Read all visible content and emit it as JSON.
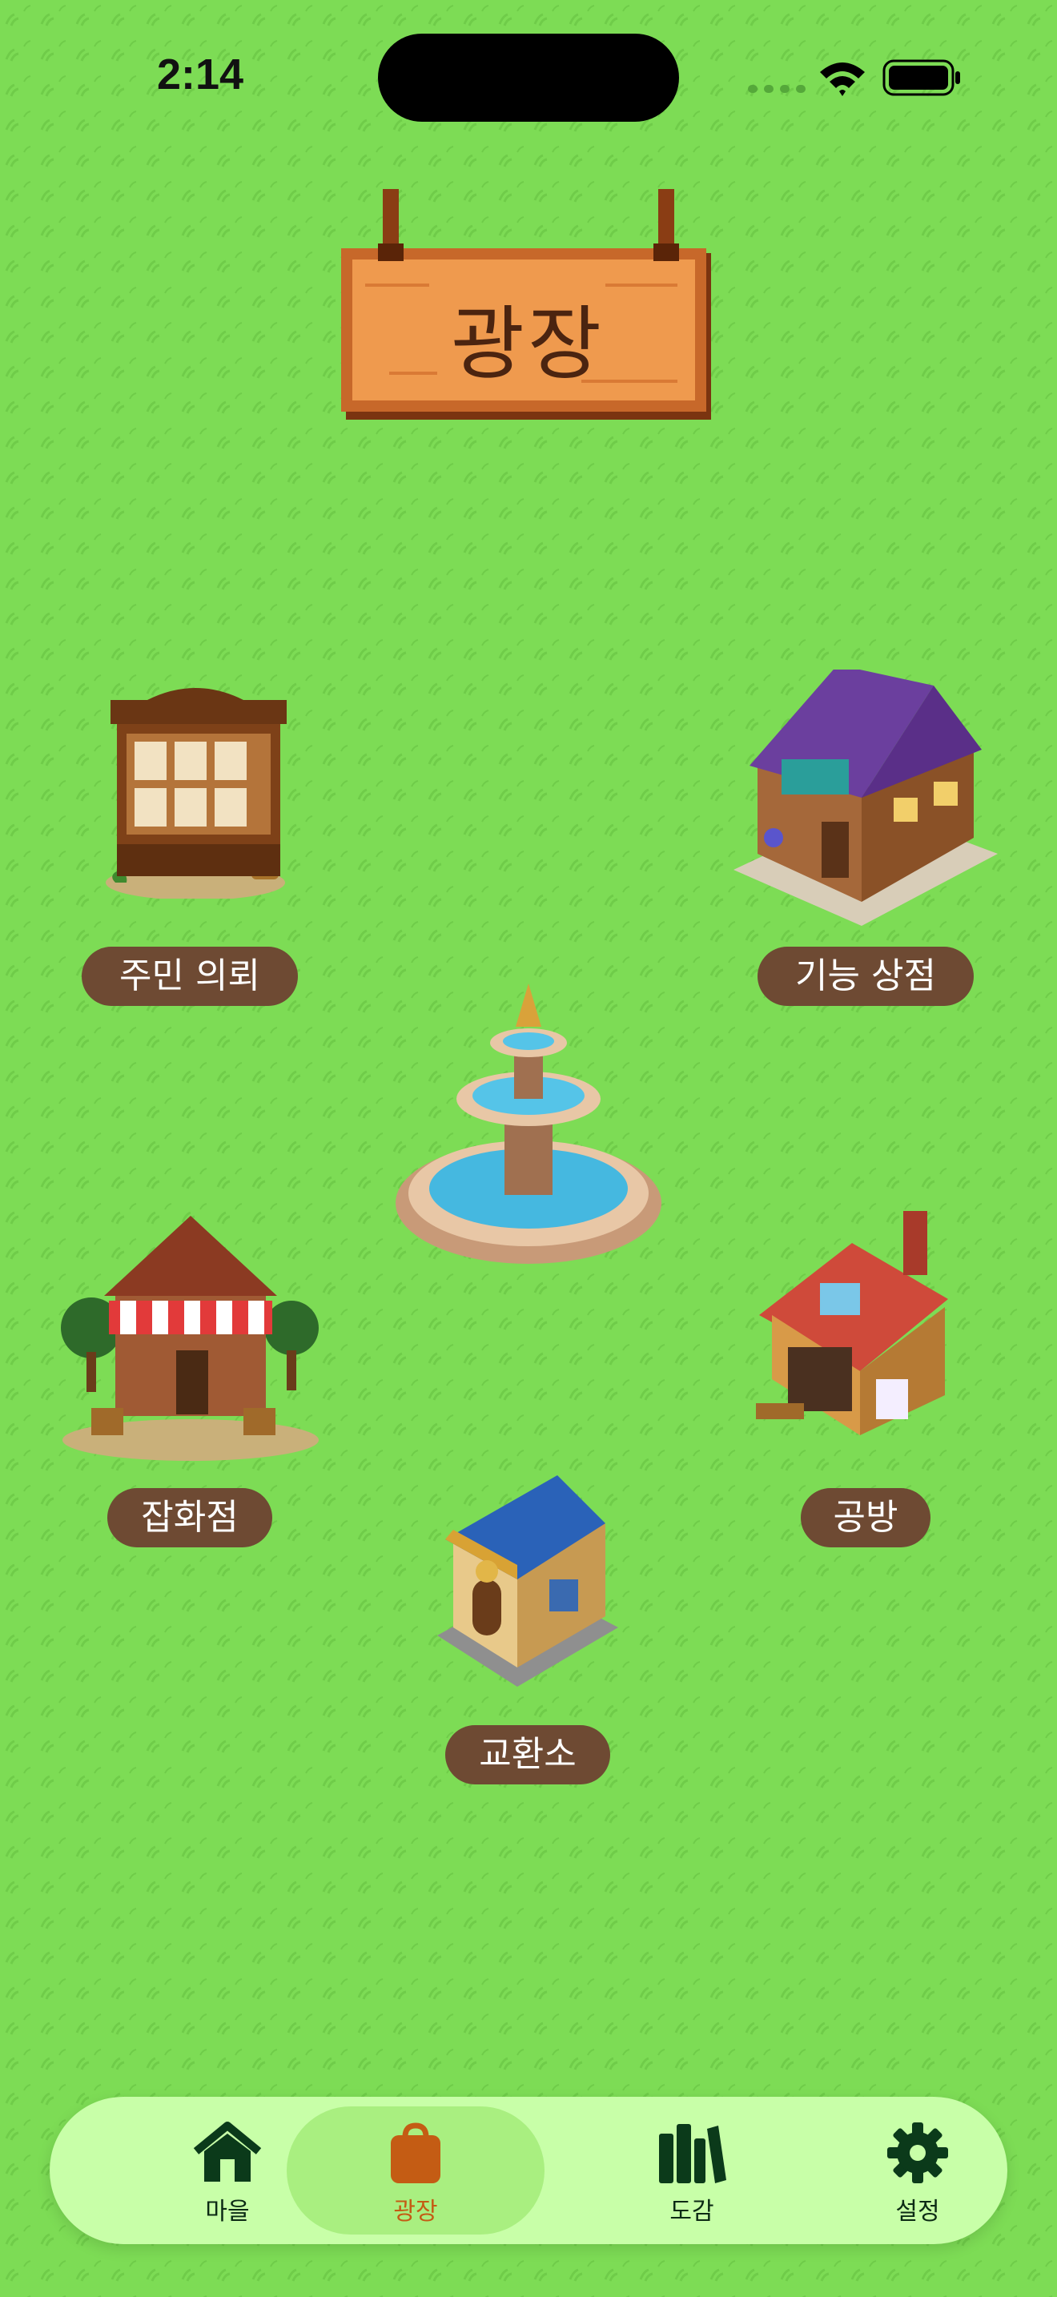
{
  "status_bar": {
    "time": "2:14"
  },
  "header": {
    "title": "광장"
  },
  "buildings": [
    {
      "id": "quest-board",
      "label": "주민 의뢰"
    },
    {
      "id": "skill-shop",
      "label": "기능 상점"
    },
    {
      "id": "general-store",
      "label": "잡화점"
    },
    {
      "id": "workshop",
      "label": "공방"
    },
    {
      "id": "exchange",
      "label": "교환소"
    }
  ],
  "tabbar": {
    "tabs": [
      {
        "label": "마을",
        "icon": "house-icon",
        "active": false
      },
      {
        "label": "광장",
        "icon": "bag-icon",
        "active": true
      },
      {
        "label": "도감",
        "icon": "books-icon",
        "active": false
      },
      {
        "label": "설정",
        "icon": "gear-icon",
        "active": false
      }
    ]
  },
  "colors": {
    "background": "#7ddc55",
    "pill": "#6e4a33",
    "tabbar": "#c8ffa8",
    "active_tab": "#a9ef80",
    "active_accent": "#c45c14"
  }
}
